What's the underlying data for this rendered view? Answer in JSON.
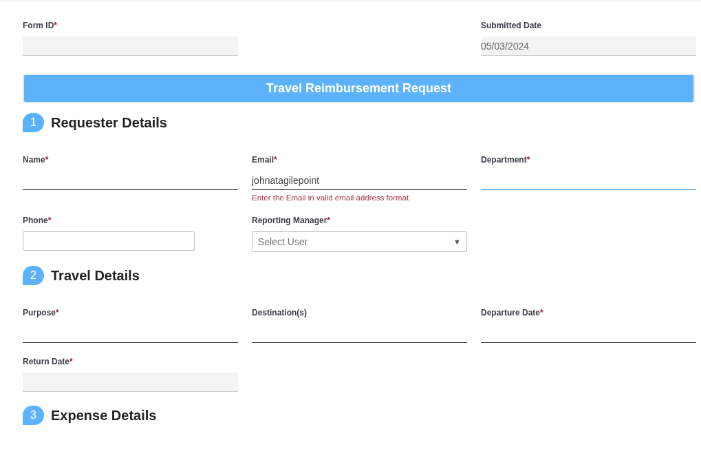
{
  "header_fields": [
    {
      "label": "Form ID",
      "required": true,
      "kind": "readonly"
    },
    {
      "label": "Submitted Date",
      "required": false,
      "kind": "readonly",
      "value": "05/03/2024"
    }
  ],
  "banner": {
    "title": "Travel Reimbursement Request"
  },
  "sections": [
    {
      "number": "1",
      "title": "Requester Details",
      "rows": [
        [
          {
            "label": "Name",
            "required": true,
            "kind": "underline",
            "focused": false
          },
          {
            "label": "Email",
            "required": true,
            "kind": "underline",
            "focused": false,
            "value": "johnatagilepoint",
            "error": "Enter the Email in valid email address format"
          },
          {
            "label": "Department",
            "required": true,
            "kind": "underline",
            "focused": true
          }
        ],
        [
          {
            "label": "Phone",
            "required": true,
            "kind": "box"
          },
          {
            "label": "Reporting Manager",
            "required": true,
            "kind": "select",
            "placeholder": "Select User",
            "caret": "▼"
          }
        ]
      ]
    },
    {
      "number": "2",
      "title": "Travel Details",
      "rows": [
        [
          {
            "label": "Purpose",
            "required": true,
            "kind": "underline",
            "focused": false
          },
          {
            "label": "Destination(s)",
            "required": false,
            "kind": "underline",
            "focused": false
          },
          {
            "label": "Departure Date",
            "required": true,
            "kind": "underline",
            "focused": false
          }
        ],
        [
          {
            "label": "Return Date",
            "required": true,
            "kind": "readonly"
          }
        ]
      ]
    },
    {
      "number": "3",
      "title": "Expense Details"
    }
  ],
  "required_mark": "*"
}
